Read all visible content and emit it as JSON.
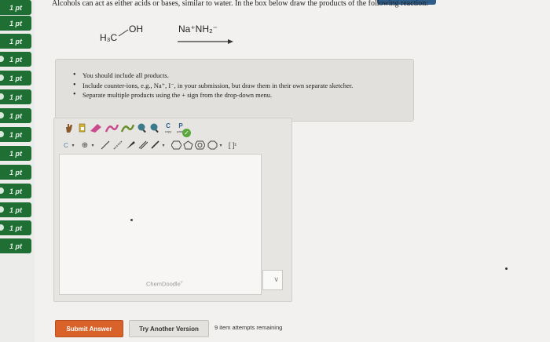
{
  "intro_text": "Alcohols can act as either acids or bases, similar to water. In the box below draw the products of the following reaction:",
  "sidebar": {
    "points": [
      "1 pt",
      "1 pt",
      "1 pt",
      "1 pt",
      "1 pt",
      "1 pt",
      "1 pt",
      "1 pt",
      "1 pt",
      "1 pt",
      "1 pt",
      "1 pt",
      "1 pt",
      "1 pt"
    ]
  },
  "reaction": {
    "reactant_left": "H₃C",
    "reactant_right": "OH",
    "reagent": "Na⁺NH₂⁻"
  },
  "instructions": [
    "You should include all products.",
    "Include counter-ions, e.g., Na⁺, I⁻, in your submission, but draw them in their own separate sketcher.",
    "Separate multiple products using the + sign from the drop-down menu."
  ],
  "sketcher": {
    "brand": "ChemDoodle",
    "toolbar1": [
      "hand-tool",
      "lasso-tool",
      "eraser-tool",
      "pan-tool",
      "zoom-in-tool",
      "zoom-out-tool",
      "copy-tool",
      "paste-tool"
    ],
    "copy_label": "C",
    "paste_label": "P",
    "copy_sub": "copy",
    "paste_sub": "paste",
    "element_label": "C",
    "valid_glyph": "✓"
  },
  "buttons": {
    "submit": "Submit Answer",
    "another": "Try Another Version"
  },
  "attempts": "9 item attempts remaining",
  "colors": {
    "accent_green": "#1f6e33",
    "submit_orange": "#d9622b",
    "top_strip_blue": "#2f5d8a"
  }
}
